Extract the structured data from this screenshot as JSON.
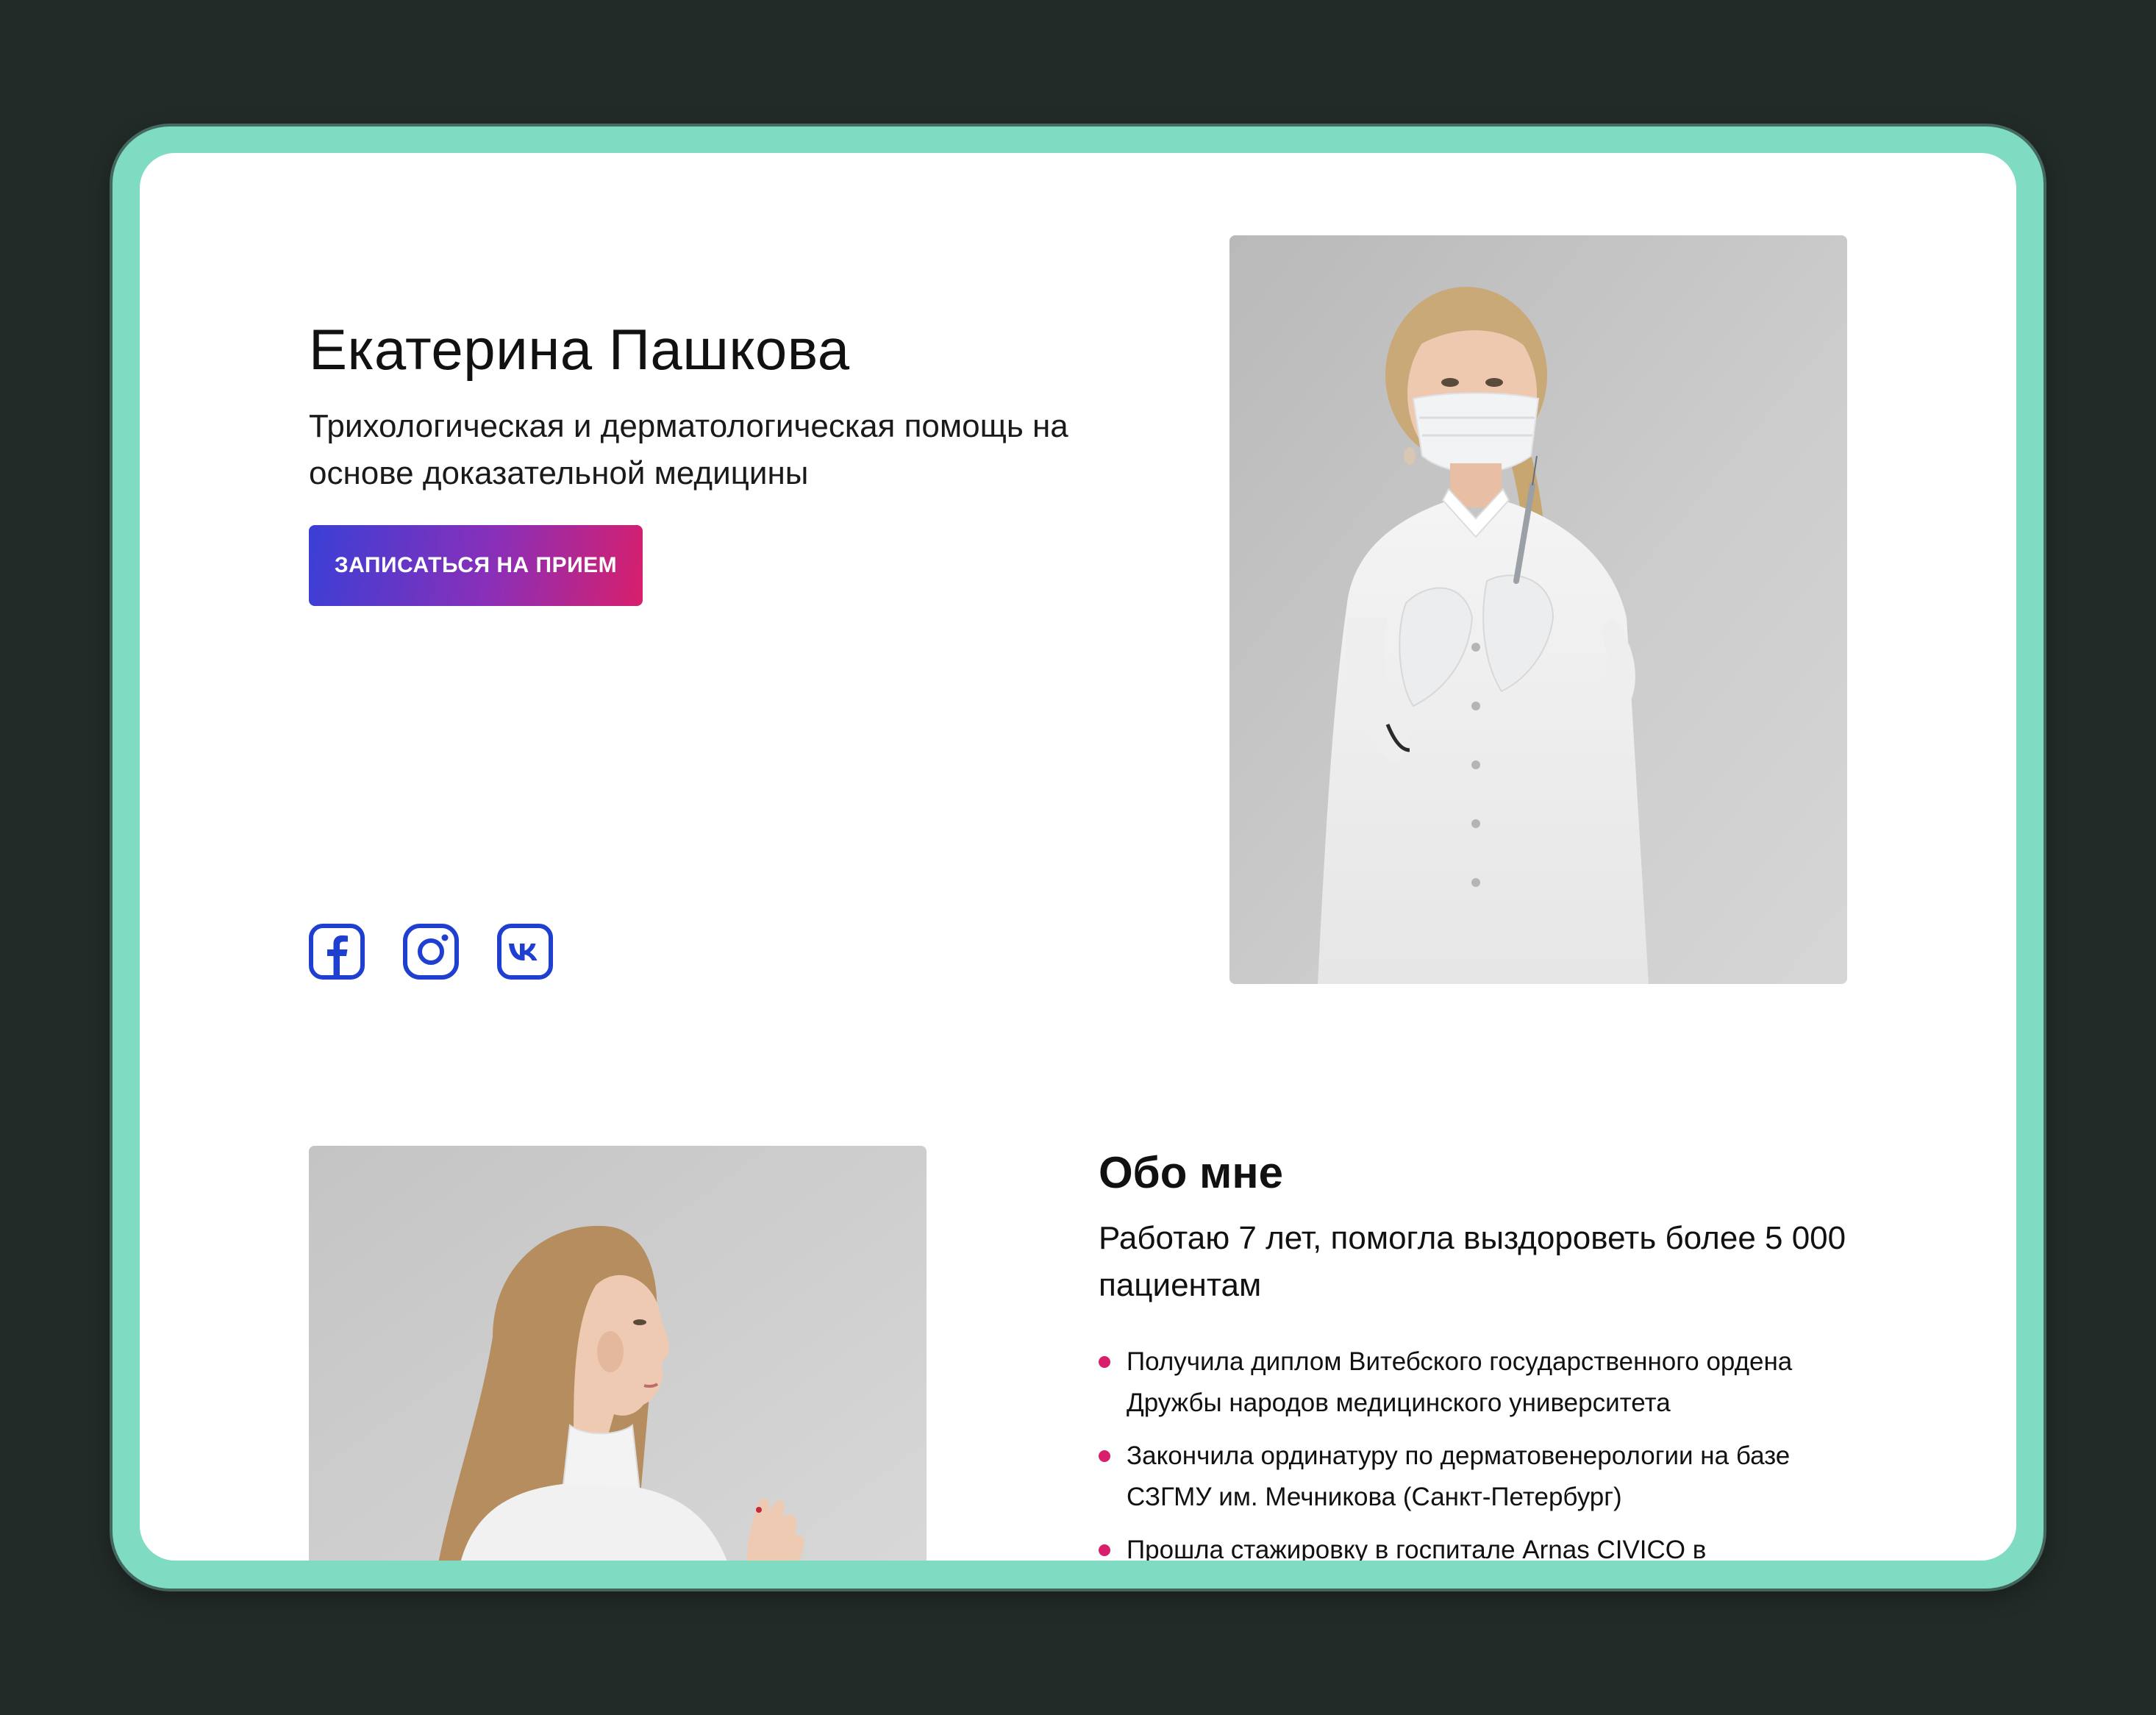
{
  "hero": {
    "name": "Екатерина Пашкова",
    "subtitle": "Трихологическая и дерматологическая помощь на основе доказательной медицины",
    "cta_label": "ЗАПИСАТЬСЯ НА ПРИЕМ"
  },
  "social": [
    {
      "icon": "facebook-icon"
    },
    {
      "icon": "instagram-icon"
    },
    {
      "icon": "vk-icon"
    }
  ],
  "about": {
    "title": "Обо мне",
    "lead": "Работаю 7 лет, помогла выздороветь более 5 000 пациентам",
    "items": [
      "Получила диплом Витебского государственного ордена Дружбы народов медицинского университета",
      "Закончила ординатуру по дерматовенерологии на базе СЗГМУ им. Мечникова (Санкт-Петербург)",
      "Прошла стажировку в госпитале Arnas CIVICO в"
    ]
  },
  "colors": {
    "page_background": "#222b28",
    "frame": "#7fdcc2",
    "accent_pink": "#d81f6c",
    "accent_blue": "#3a3fd6",
    "icon_blue": "#1f3fd1"
  }
}
